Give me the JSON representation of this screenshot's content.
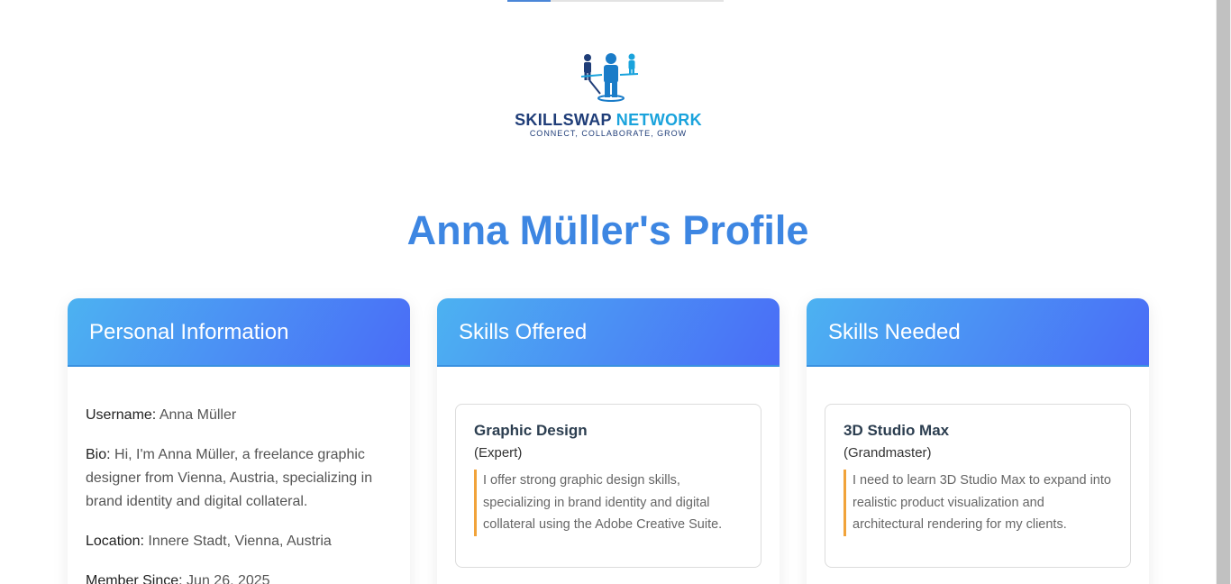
{
  "progress": {
    "value": 0.2
  },
  "logo": {
    "name_part1": "SKILLSWAP",
    "name_part2": "NETWORK",
    "tagline": "CONNECT, COLLABORATE, GROW",
    "icon": "people-network-icon"
  },
  "page_title": "Anna Müller's Profile",
  "personal": {
    "header": "Personal Information",
    "rows": [
      {
        "key": "Username:",
        "value": "Anna Müller"
      },
      {
        "key": "Bio:",
        "value": "Hi, I'm Anna Müller, a freelance graphic designer from Vienna, Austria, specializing in brand identity and digital collateral."
      },
      {
        "key": "Location:",
        "value": "Innere Stadt, Vienna, Austria"
      },
      {
        "key": "Member Since:",
        "value": "Jun 26, 2025"
      }
    ]
  },
  "offered": {
    "header": "Skills Offered",
    "skill": {
      "name": "Graphic Design",
      "level": "(Expert)",
      "description": "I offer strong graphic design skills, specializing in brand identity and digital collateral using the Adobe Creative Suite."
    }
  },
  "needed": {
    "header": "Skills Needed",
    "skill": {
      "name": "3D Studio Max",
      "level": "(Grandmaster)",
      "description": "I need to learn 3D Studio Max to expand into realistic product visualization and architectural rendering for my clients."
    }
  },
  "colors": {
    "accent": "#3d86e2",
    "header_gradient_start": "#4cb2f1",
    "header_gradient_end": "#4a6cf7",
    "desc_border": "#f1a33a"
  }
}
